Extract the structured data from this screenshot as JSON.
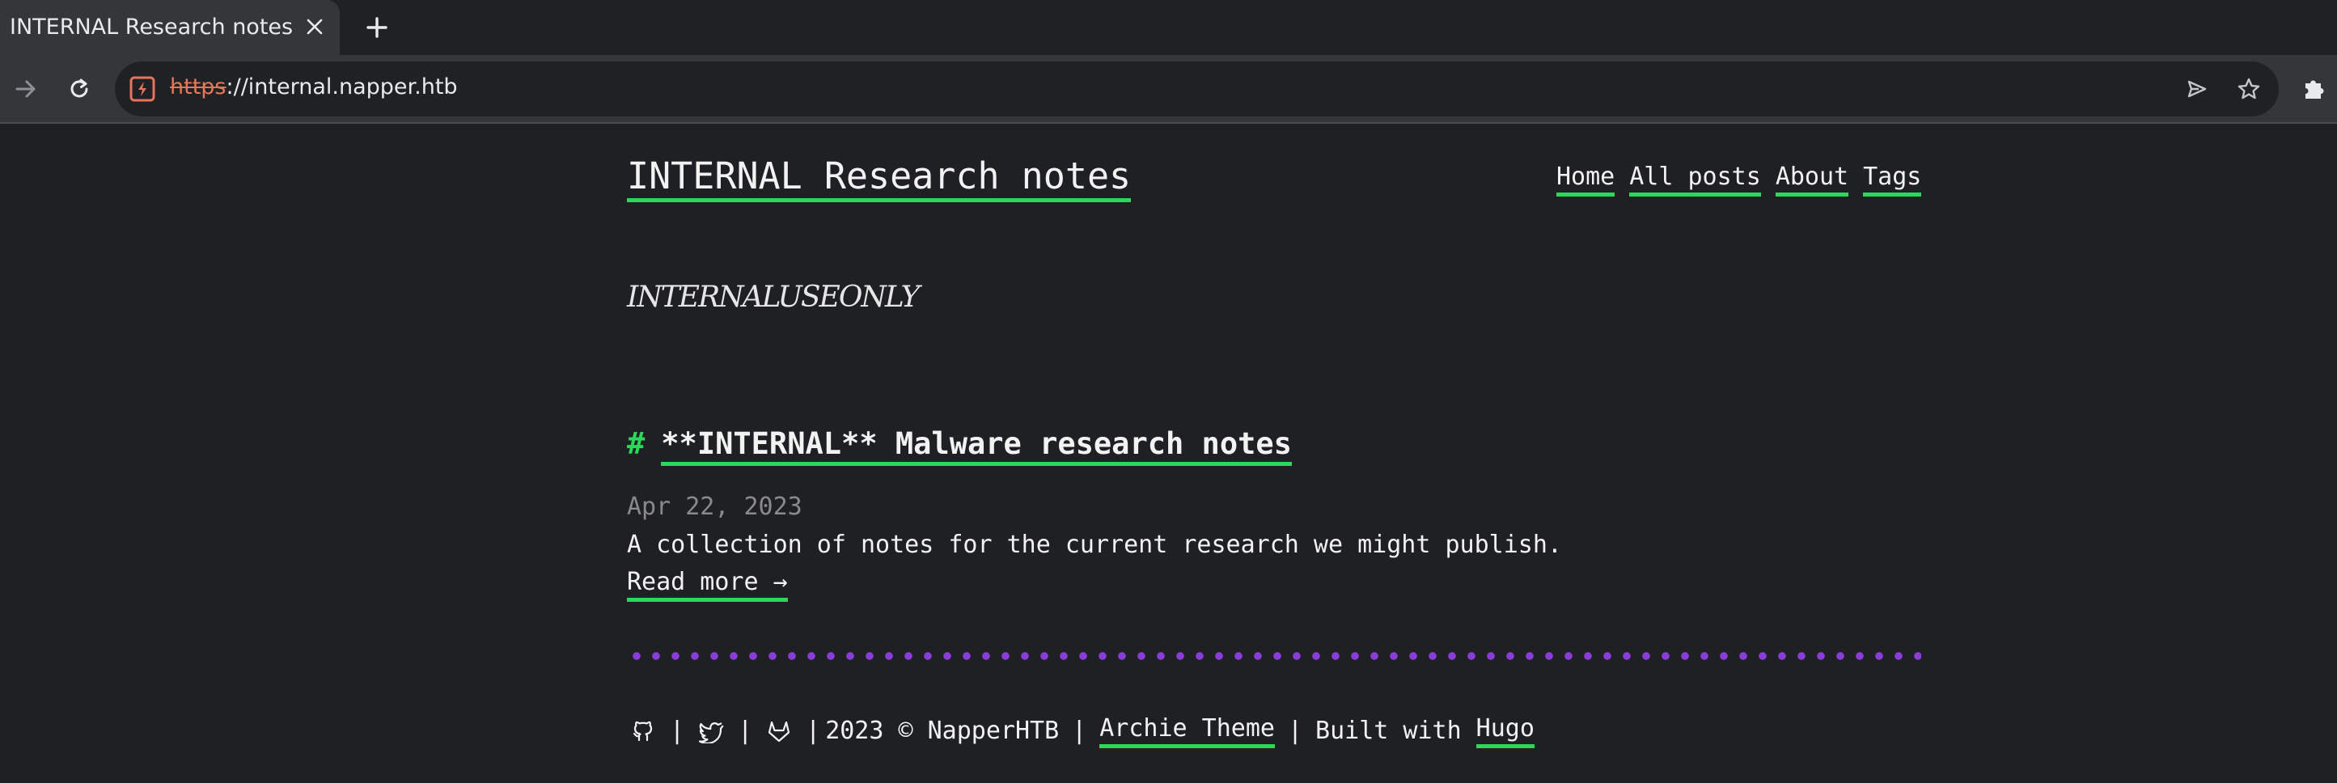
{
  "browser": {
    "tab_title": "INTERNAL Research notes | ",
    "url_scheme": "https",
    "url_rest": "://internal.napper.htb"
  },
  "site": {
    "title": "INTERNAL Research notes",
    "nav": [
      "Home",
      "All posts",
      "About",
      "Tags"
    ],
    "tagline": "INTERNALUSEONLY"
  },
  "post": {
    "hash": "#",
    "title": "**INTERNAL** Malware research notes",
    "date": "Apr 22, 2023",
    "summary": "A collection of notes for the current research we might publish.",
    "read_more": "Read more →"
  },
  "footer": {
    "copyright": "2023 © NapperHTB",
    "sep": "|",
    "theme_link": "Archie Theme",
    "built_with": "Built with",
    "hugo_link": "Hugo",
    "icons": [
      "github-icon",
      "twitter-icon",
      "gitlab-icon"
    ]
  },
  "colors": {
    "accent_green": "#2bd85a",
    "dot_purple": "#8a3ddb",
    "background": "#1f2023"
  }
}
